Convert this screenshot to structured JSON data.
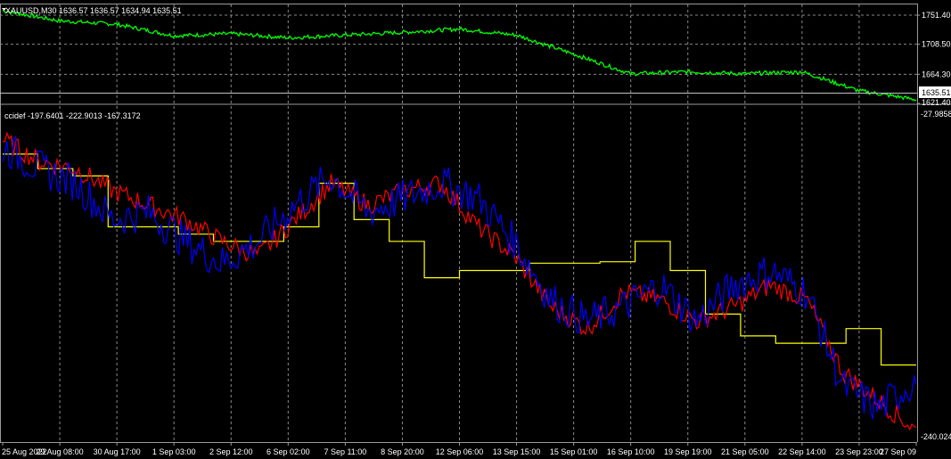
{
  "main_chart": {
    "header": "XAUUSD,M30  1636.57 1636.57 1634.94 1635.51",
    "price_ticks": [
      "1751.40",
      "1708.50",
      "1664.30",
      "1621.40"
    ],
    "current_price": "1635.51",
    "line_color": "#00ff00"
  },
  "indicator": {
    "header": "ccidef -197.6401 -222.9013 -167.3172",
    "top_value": "-27.9858",
    "bottom_value": "-240.0249",
    "colors": {
      "yellow": "#ffff00",
      "red": "#ff0000",
      "blue": "#0000ff"
    }
  },
  "time_axis": {
    "labels": [
      "25 Aug 2022",
      "29 Aug 08:00",
      "30 Aug 17:00",
      "1 Sep 03:00",
      "2 Sep 12:00",
      "6 Sep 02:00",
      "7 Sep 11:00",
      "8 Sep 20:00",
      "12 Sep 06:00",
      "13 Sep 15:00",
      "15 Sep 01:00",
      "16 Sep 10:00",
      "19 Sep 19:00",
      "21 Sep 05:00",
      "22 Sep 14:00",
      "23 Sep 23:00",
      "27 Sep 09"
    ]
  },
  "chart_data": [
    {
      "type": "line",
      "title": "XAUUSD,M30",
      "ylim": [
        1621.4,
        1751.4
      ],
      "series": [
        {
          "name": "XAUUSD",
          "x": [
            "25 Aug 2022",
            "29 Aug 08:00",
            "30 Aug 17:00",
            "1 Sep 03:00",
            "2 Sep 12:00",
            "6 Sep 02:00",
            "7 Sep 11:00",
            "8 Sep 20:00",
            "12 Sep 06:00",
            "13 Sep 15:00",
            "15 Sep 01:00",
            "16 Sep 10:00",
            "19 Sep 19:00",
            "21 Sep 05:00",
            "22 Sep 14:00",
            "23 Sep 23:00",
            "27 Sep 09"
          ],
          "values": [
            1758,
            1743,
            1738,
            1721,
            1724,
            1718,
            1722,
            1726,
            1731,
            1722,
            1694,
            1665,
            1668,
            1665,
            1668,
            1640,
            1627
          ]
        }
      ]
    },
    {
      "type": "line",
      "title": "ccidef",
      "ylim": [
        -240.0249,
        -27.9858
      ],
      "series": [
        {
          "name": "ccidef yellow",
          "values": [
            -50,
            -60,
            -65,
            -100,
            -100,
            -105,
            -110,
            -110,
            -100,
            -70,
            -95,
            -110,
            -135,
            -130,
            -130,
            -125,
            -125,
            -124,
            -110,
            -130,
            -160,
            -175,
            -180,
            -180,
            -170,
            -195
          ]
        },
        {
          "name": "ccidef red",
          "values": [
            -40,
            -55,
            -60,
            -75,
            -85,
            -95,
            -110,
            -120,
            -95,
            -70,
            -85,
            -75,
            -70,
            -100,
            -120,
            -155,
            -170,
            -145,
            -150,
            -165,
            -155,
            -140,
            -150,
            -200,
            -220,
            -240
          ]
        },
        {
          "name": "ccidef blue",
          "values": [
            -45,
            -60,
            -70,
            -95,
            -90,
            -110,
            -125,
            -110,
            -85,
            -65,
            -90,
            -80,
            -70,
            -80,
            -110,
            -150,
            -165,
            -155,
            -140,
            -165,
            -140,
            -130,
            -145,
            -210,
            -225,
            -205
          ]
        }
      ]
    }
  ]
}
